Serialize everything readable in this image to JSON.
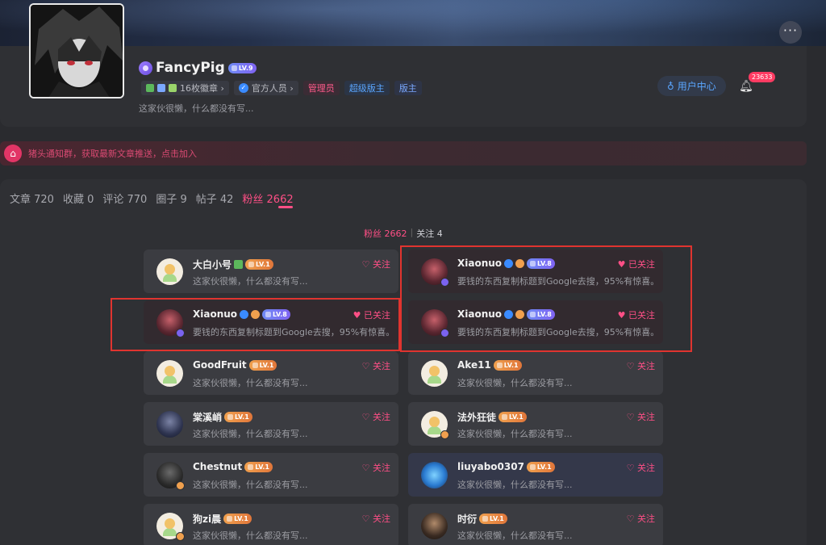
{
  "profile": {
    "name": "FancyPig",
    "level": "LV.9",
    "collection_badge": "16枚徽章 ›",
    "official": "官方人员 ›",
    "role_admin": "管理员",
    "role_super": "超级版主",
    "role_mod": "版主",
    "bio": "这家伙很懒，什么都没有写...",
    "user_center": "用户中心",
    "notification_count": "23633",
    "more_icon": "more-icon"
  },
  "notice": {
    "text": "猪头通知群，获取最新文章推送，点击加入"
  },
  "tabs": [
    {
      "label": "文章 720"
    },
    {
      "label": "收藏 0"
    },
    {
      "label": "评论 770"
    },
    {
      "label": "圈子 9"
    },
    {
      "label": "帖子 42"
    },
    {
      "label": "粉丝 2662"
    }
  ],
  "subtabs": {
    "fans": "粉丝 2662",
    "separator": "|",
    "follow": "关注 4"
  },
  "cards": [
    {
      "name": "大白小号",
      "level": "LV.1",
      "desc": "这家伙很懒，什么都没有写...",
      "action": "♡ 关注"
    },
    {
      "name": "Xiaonuo",
      "level": "LV.8",
      "desc": "要钱的东西复制标题到Google去搜，95%有惊喜。",
      "action": "♥ 已关注"
    },
    {
      "name": "Xiaonuo",
      "level": "LV.8",
      "desc": "要钱的东西复制标题到Google去搜，95%有惊喜。",
      "action": "♥ 已关注"
    },
    {
      "name": "Xiaonuo",
      "level": "LV.8",
      "desc": "要钱的东西复制标题到Google去搜，95%有惊喜。",
      "action": "♥ 已关注"
    },
    {
      "name": "GoodFruit",
      "level": "LV.1",
      "desc": "这家伙很懒，什么都没有写...",
      "action": "♡ 关注"
    },
    {
      "name": "Ake11",
      "level": "LV.1",
      "desc": "这家伙很懒，什么都没有写...",
      "action": "♡ 关注"
    },
    {
      "name": "棠溪峭",
      "level": "LV.1",
      "desc": "这家伙很懒，什么都没有写...",
      "action": "♡ 关注"
    },
    {
      "name": "法外狂徒",
      "level": "LV.1",
      "desc": "这家伙很懒，什么都没有写...",
      "action": "♡ 关注"
    },
    {
      "name": "Chestnut",
      "level": "LV.1",
      "desc": "这家伙很懒，什么都没有写...",
      "action": "♡ 关注"
    },
    {
      "name": "liuyabo0307",
      "level": "LV.1",
      "desc": "这家伙很懒，什么都没有写...",
      "action": "♡ 关注"
    },
    {
      "name": "狗zi晨",
      "level": "LV.1",
      "desc": "这家伙很懒，什么都没有写...",
      "action": "♡ 关注"
    },
    {
      "name": "时衍",
      "level": "LV.1",
      "desc": "这家伙很懒，什么都没有写...",
      "action": "♡ 关注"
    }
  ],
  "colors": {
    "accent": "#ff4f86",
    "highlight_box": "#e0342f",
    "link_blue": "#5aa6ff"
  }
}
